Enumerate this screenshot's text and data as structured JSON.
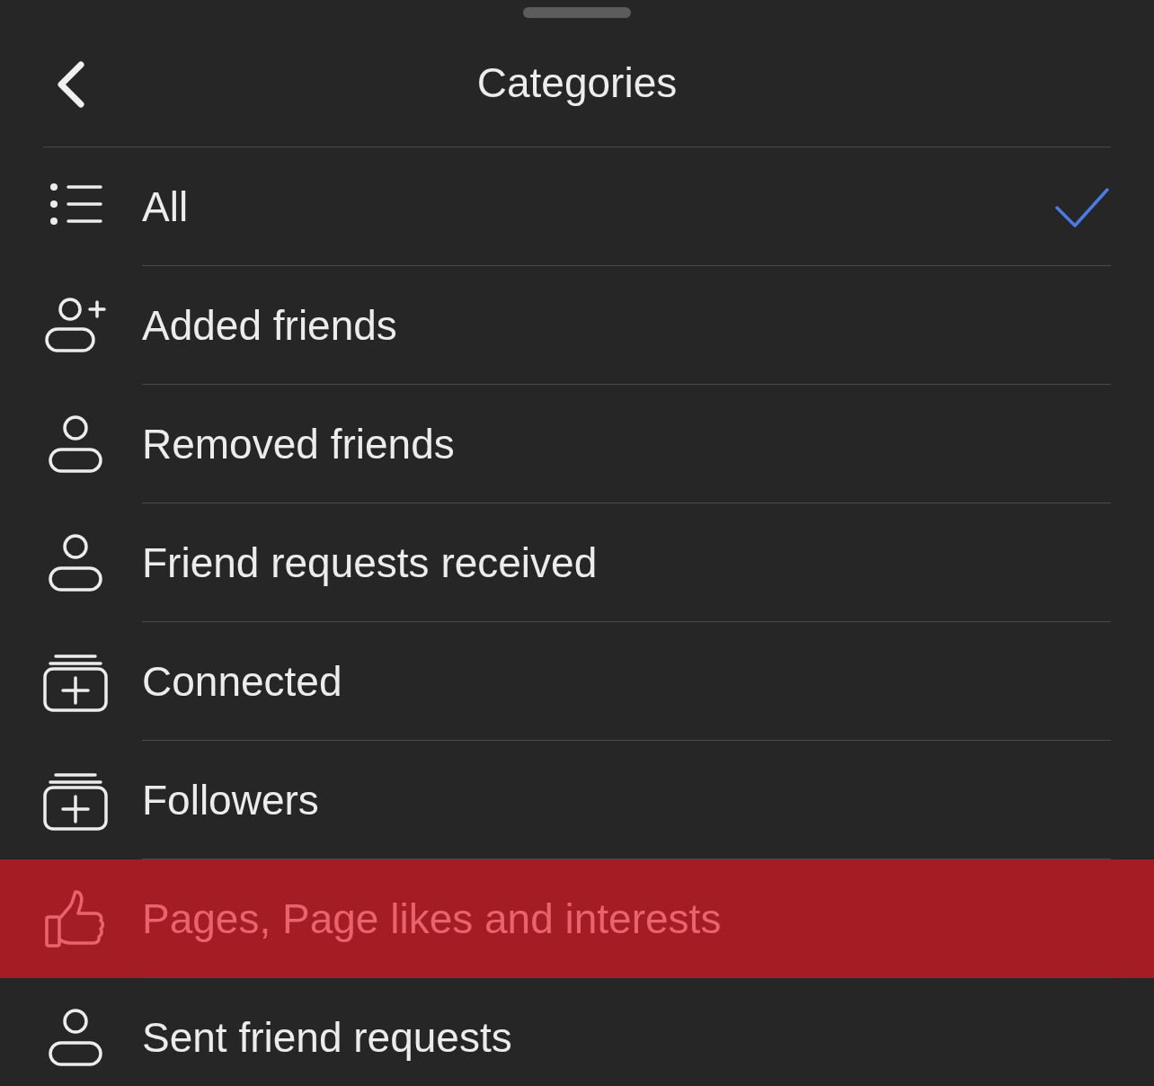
{
  "header": {
    "title": "Categories"
  },
  "items": [
    {
      "label": "All",
      "kind": "list",
      "selected": true,
      "highlighted": false
    },
    {
      "label": "Added friends",
      "kind": "person-plus",
      "selected": false,
      "highlighted": false
    },
    {
      "label": "Removed friends",
      "kind": "person",
      "selected": false,
      "highlighted": false
    },
    {
      "label": "Friend requests received",
      "kind": "person",
      "selected": false,
      "highlighted": false
    },
    {
      "label": "Connected",
      "kind": "stack-plus",
      "selected": false,
      "highlighted": false
    },
    {
      "label": "Followers",
      "kind": "stack-plus",
      "selected": false,
      "highlighted": false
    },
    {
      "label": "Pages, Page likes and interests",
      "kind": "thumb",
      "selected": false,
      "highlighted": true
    },
    {
      "label": "Sent friend requests",
      "kind": "person",
      "selected": false,
      "highlighted": false
    }
  ]
}
